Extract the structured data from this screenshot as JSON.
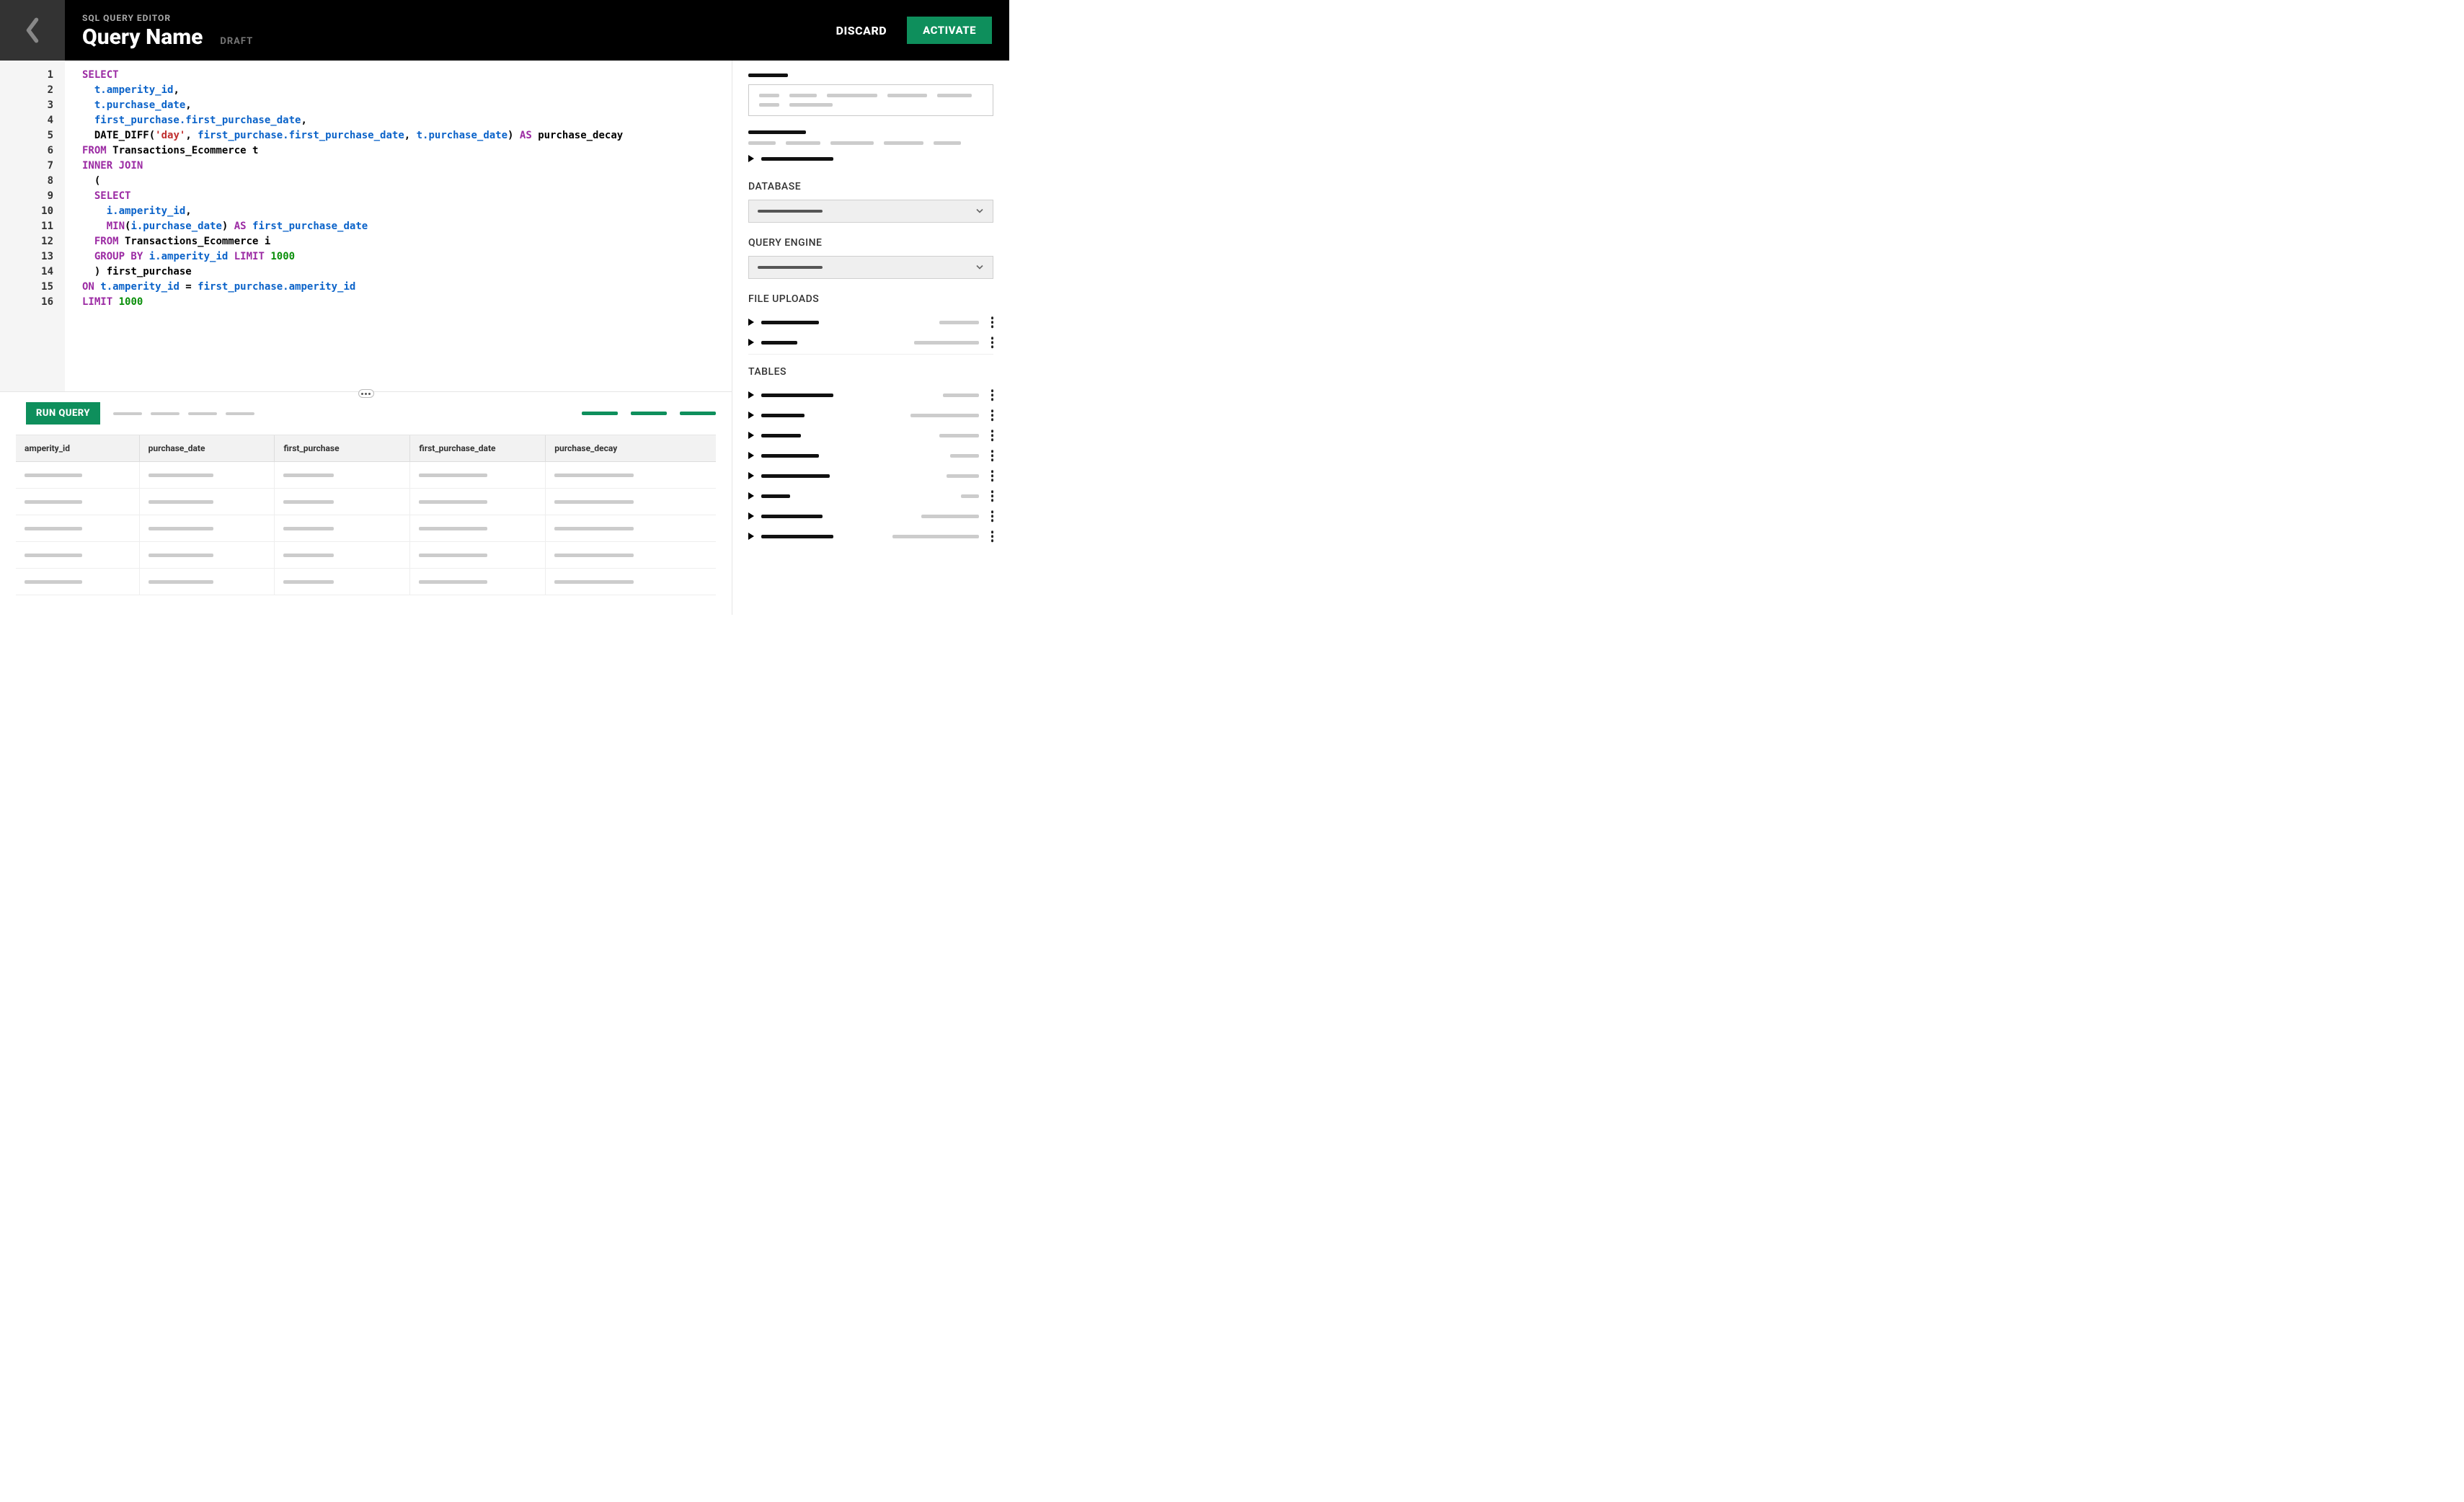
{
  "header": {
    "subtitle": "SQL QUERY EDITOR",
    "title": "Query Name",
    "status": "DRAFT",
    "discard": "DISCARD",
    "activate": "ACTIVATE"
  },
  "editor": {
    "line_numbers": [
      "1",
      "2",
      "3",
      "4",
      "5",
      "6",
      "7",
      "8",
      "9",
      "10",
      "11",
      "12",
      "13",
      "14",
      "15",
      "16"
    ],
    "code_lines": [
      [
        {
          "cls": "kw-purple",
          "t": "SELECT"
        }
      ],
      [
        {
          "cls": "",
          "t": "  "
        },
        {
          "cls": "kw-blue",
          "t": "t.amperity_id"
        },
        {
          "cls": "kw-black",
          "t": ","
        }
      ],
      [
        {
          "cls": "",
          "t": "  "
        },
        {
          "cls": "kw-blue",
          "t": "t.purchase_date"
        },
        {
          "cls": "kw-black",
          "t": ","
        }
      ],
      [
        {
          "cls": "",
          "t": "  "
        },
        {
          "cls": "kw-blue",
          "t": "first_purchase.first_purchase_date"
        },
        {
          "cls": "kw-black",
          "t": ","
        }
      ],
      [
        {
          "cls": "",
          "t": "  "
        },
        {
          "cls": "kw-black",
          "t": "DATE_DIFF("
        },
        {
          "cls": "kw-red",
          "t": "'day'"
        },
        {
          "cls": "kw-black",
          "t": ", "
        },
        {
          "cls": "kw-blue",
          "t": "first_purchase.first_purchase_date"
        },
        {
          "cls": "kw-black",
          "t": ", "
        },
        {
          "cls": "kw-blue",
          "t": "t.purchase_date"
        },
        {
          "cls": "kw-black",
          "t": ") "
        },
        {
          "cls": "kw-purple",
          "t": "AS"
        },
        {
          "cls": "kw-black",
          "t": " purchase_decay"
        }
      ],
      [
        {
          "cls": "kw-purple",
          "t": "FROM"
        },
        {
          "cls": "kw-black",
          "t": " Transactions_Ecommerce t"
        }
      ],
      [
        {
          "cls": "kw-purple",
          "t": "INNER JOIN"
        }
      ],
      [
        {
          "cls": "",
          "t": "  "
        },
        {
          "cls": "kw-black",
          "t": "("
        }
      ],
      [
        {
          "cls": "",
          "t": "  "
        },
        {
          "cls": "kw-purple",
          "t": "SELECT"
        }
      ],
      [
        {
          "cls": "",
          "t": "    "
        },
        {
          "cls": "kw-blue",
          "t": "i.amperity_id"
        },
        {
          "cls": "kw-black",
          "t": ","
        }
      ],
      [
        {
          "cls": "",
          "t": "    "
        },
        {
          "cls": "kw-purple",
          "t": "MIN"
        },
        {
          "cls": "kw-black",
          "t": "("
        },
        {
          "cls": "kw-blue",
          "t": "i.purchase_date"
        },
        {
          "cls": "kw-black",
          "t": ") "
        },
        {
          "cls": "kw-purple",
          "t": "AS"
        },
        {
          "cls": "kw-black",
          "t": " "
        },
        {
          "cls": "kw-blue",
          "t": "first_purchase_date"
        }
      ],
      [
        {
          "cls": "",
          "t": "  "
        },
        {
          "cls": "kw-purple",
          "t": "FROM"
        },
        {
          "cls": "kw-black",
          "t": " Transactions_Ecommerce i"
        }
      ],
      [
        {
          "cls": "",
          "t": "  "
        },
        {
          "cls": "kw-purple",
          "t": "GROUP BY"
        },
        {
          "cls": "kw-black",
          "t": " "
        },
        {
          "cls": "kw-blue",
          "t": "i.amperity_id"
        },
        {
          "cls": "kw-black",
          "t": " "
        },
        {
          "cls": "kw-purple",
          "t": "LIMIT"
        },
        {
          "cls": "kw-black",
          "t": " "
        },
        {
          "cls": "kw-green",
          "t": "1000"
        }
      ],
      [
        {
          "cls": "",
          "t": "  "
        },
        {
          "cls": "kw-black",
          "t": ") first_purchase"
        }
      ],
      [
        {
          "cls": "kw-purple",
          "t": "ON"
        },
        {
          "cls": "kw-black",
          "t": " "
        },
        {
          "cls": "kw-blue",
          "t": "t.amperity_id"
        },
        {
          "cls": "kw-black",
          "t": " = "
        },
        {
          "cls": "kw-blue",
          "t": "first_purchase.amperity_id"
        }
      ],
      [
        {
          "cls": "kw-purple",
          "t": "LIMIT"
        },
        {
          "cls": "kw-black",
          "t": " "
        },
        {
          "cls": "kw-green",
          "t": "1000"
        }
      ]
    ]
  },
  "runbar": {
    "run": "RUN QUERY"
  },
  "results": {
    "columns": [
      "amperity_id",
      "purchase_date",
      "first_purchase",
      "first_purchase_date",
      "purchase_decay"
    ],
    "row_count": 5,
    "placeholder_widths": [
      80,
      90,
      70,
      95,
      110
    ]
  },
  "right": {
    "database_label": "DATABASE",
    "engine_label": "QUERY ENGINE",
    "uploads_label": "FILE UPLOADS",
    "tables_label": "TABLES",
    "uploads_count": 2,
    "upload_bar_widths": [
      80,
      50
    ],
    "upload_right_widths": [
      55,
      90
    ],
    "tables_count": 8,
    "table_bar_widths": [
      100,
      60,
      55,
      80,
      95,
      40,
      85,
      100
    ],
    "table_right_widths": [
      50,
      95,
      55,
      40,
      45,
      25,
      80,
      120
    ]
  }
}
